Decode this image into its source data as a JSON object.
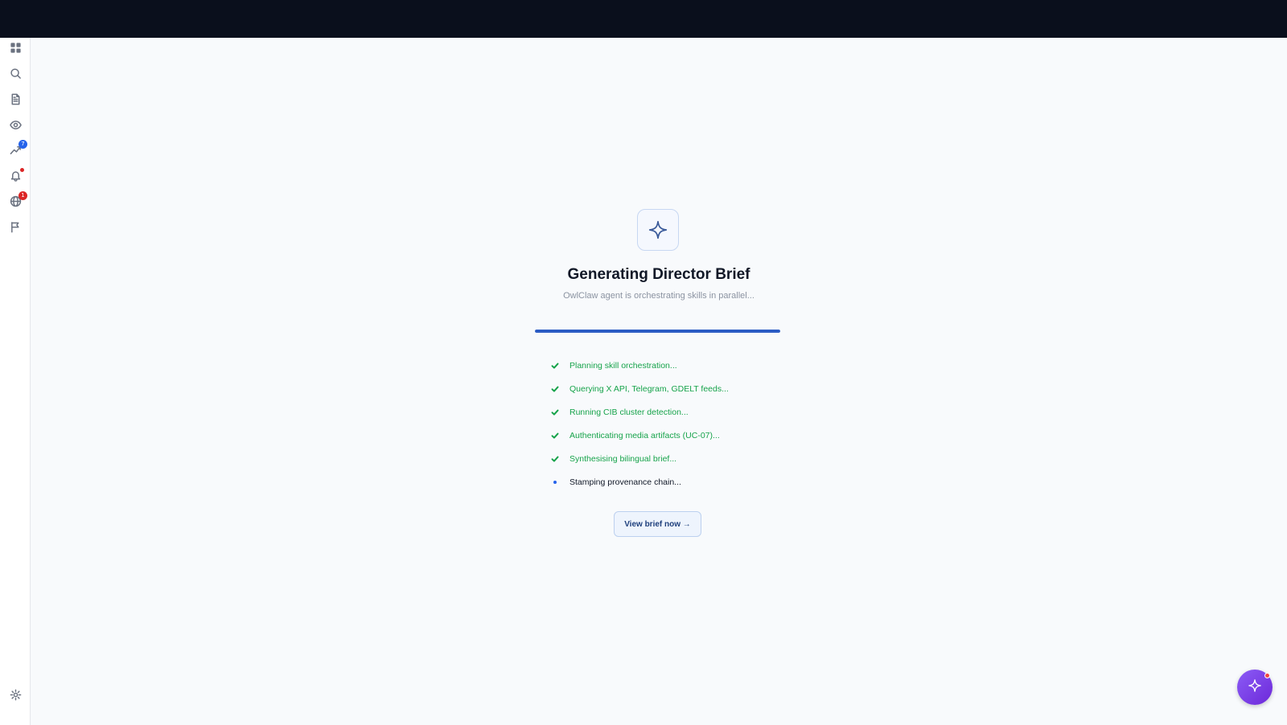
{
  "sidebar": {
    "items": [
      {
        "name": "dashboard-icon"
      },
      {
        "name": "search-icon"
      },
      {
        "name": "document-icon"
      },
      {
        "name": "eye-icon"
      },
      {
        "name": "chart-trend-icon",
        "badge": "7"
      },
      {
        "name": "bell-icon",
        "dot": true
      },
      {
        "name": "globe-icon",
        "badge": "1"
      },
      {
        "name": "flag-icon"
      }
    ],
    "footer": {
      "name": "settings-icon"
    }
  },
  "main": {
    "title": "Generating Director Brief",
    "subtitle": "OwlClaw agent is orchestrating skills in parallel...",
    "progress": 1.0,
    "steps": [
      {
        "label": "Planning skill orchestration...",
        "status": "done"
      },
      {
        "label": "Querying X API, Telegram, GDELT feeds...",
        "status": "done"
      },
      {
        "label": "Running CIB cluster detection...",
        "status": "done"
      },
      {
        "label": "Authenticating media artifacts (UC-07)...",
        "status": "done"
      },
      {
        "label": "Synthesising bilingual brief...",
        "status": "done"
      },
      {
        "label": "Stamping provenance chain...",
        "status": "active"
      }
    ],
    "view_button": "View brief now →"
  },
  "colors": {
    "topbar": "#0a0f1c",
    "accent": "#2b5cc4",
    "done": "#16a34a",
    "fab": "#7c3aed",
    "badge_blue": "#2563eb",
    "badge_red": "#dc2626"
  }
}
